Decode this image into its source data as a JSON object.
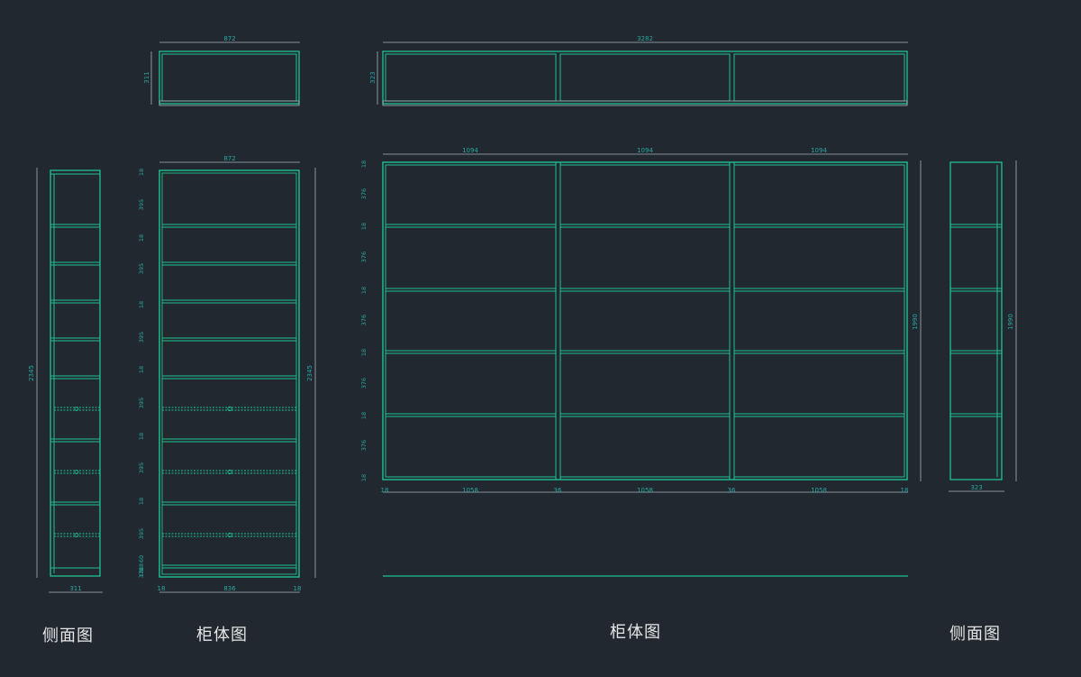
{
  "colors": {
    "background": "#212830",
    "panel_line": "#1ec28f",
    "panel_fill": "#0f3b33",
    "dim_line": "#a7b0b8",
    "dim_text": "#2aa6a0",
    "caption": "#e6e6e6"
  },
  "views": {
    "left_top_plan": {
      "width_label": "872",
      "depth_label": "311"
    },
    "left_side": {
      "height_label": "2345",
      "width_label": "311"
    },
    "left_front": {
      "width_top": "872",
      "height_label": "2345",
      "shelf_labels": [
        "18",
        "395",
        "18",
        "395",
        "18",
        "395",
        "18",
        "395",
        "18",
        "395",
        "18",
        "395",
        "18",
        "378",
        "60",
        "18"
      ],
      "bottom_labels": [
        "18",
        "836",
        "18"
      ]
    },
    "main_top_plan": {
      "width_label": "3282",
      "depth_label": "323"
    },
    "main_front": {
      "column_labels": [
        "1094",
        "1094",
        "1094"
      ],
      "height_label": "1990",
      "vertical_labels": [
        "18",
        "376",
        "18",
        "376",
        "18",
        "376",
        "18",
        "376",
        "18",
        "376",
        "18"
      ],
      "bottom_labels": [
        "18",
        "1058",
        "36",
        "1058",
        "36",
        "1058",
        "18"
      ]
    },
    "right_side": {
      "height_label": "1990",
      "width_label": "323"
    }
  },
  "captions": {
    "left_side": "侧面图",
    "left_front": "柜体图",
    "main_front": "柜体图",
    "right_side": "侧面图"
  }
}
